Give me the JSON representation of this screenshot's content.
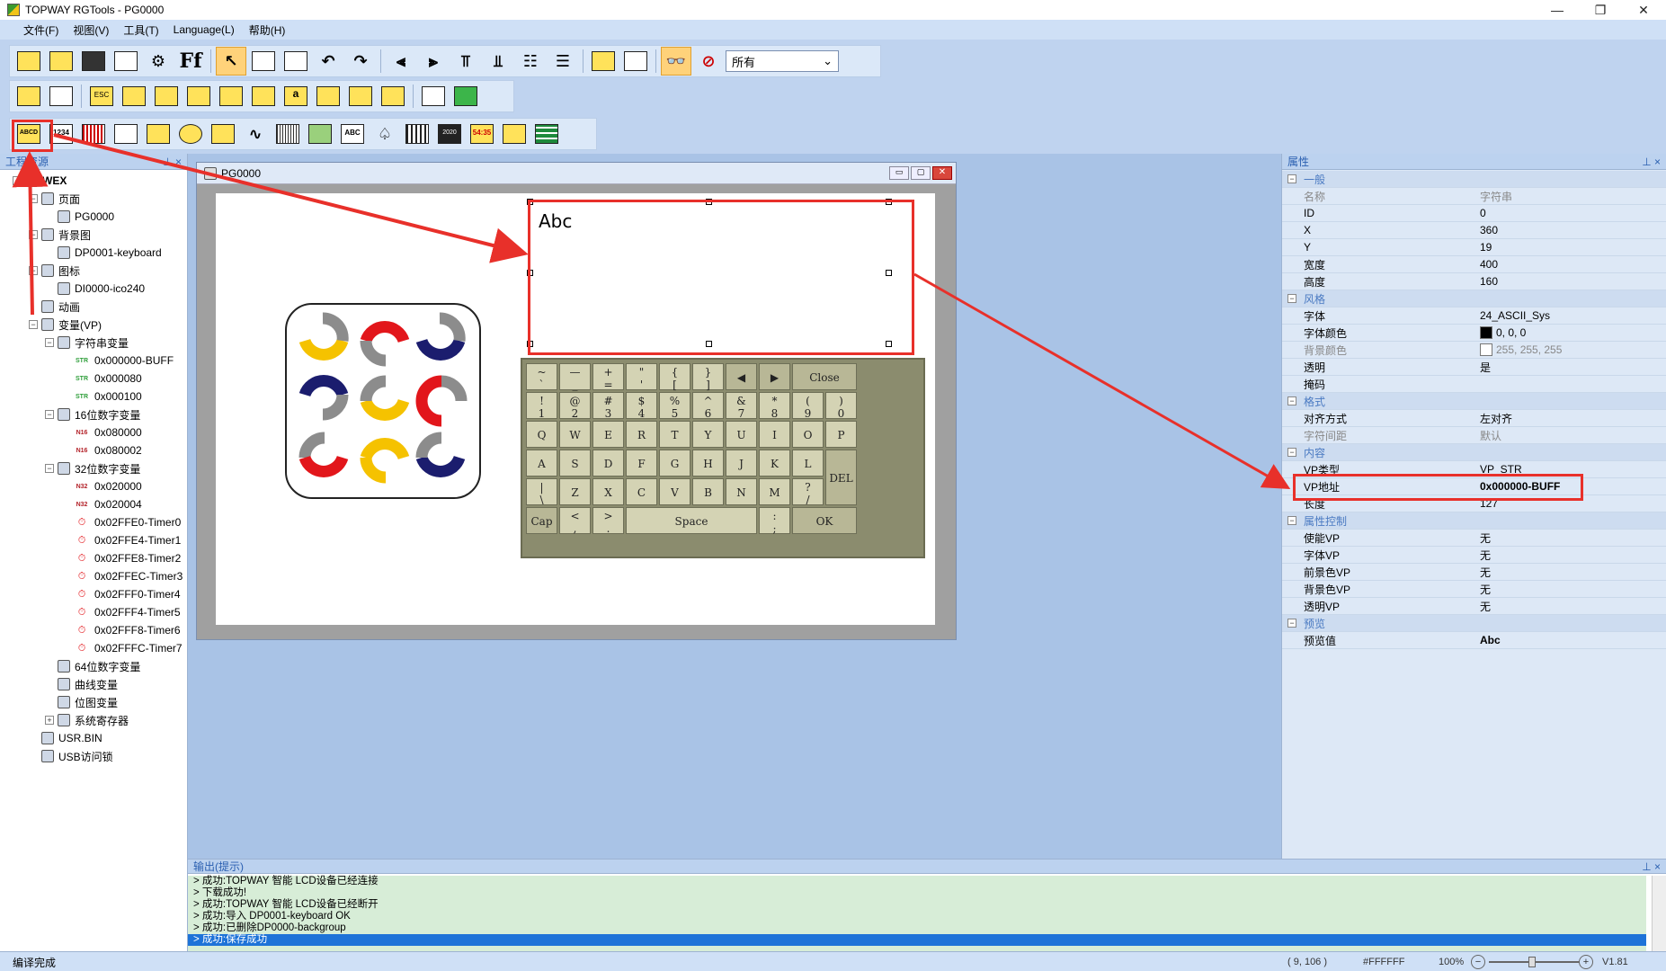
{
  "window": {
    "title": "TOPWAY RGTools - PG0000",
    "min": "—",
    "restore": "❐",
    "close": "✕"
  },
  "menu": [
    "文件(F)",
    "视图(V)",
    "工具(T)",
    "Language(L)",
    "帮助(H)"
  ],
  "toolbar": {
    "filter_value": "所有",
    "row1_icons": [
      "new-icon",
      "open-icon",
      "save-icon",
      "save-as-icon",
      "settings-icon",
      "font-icon",
      "pointer-icon",
      "copy-icon",
      "paste-icon",
      "undo-icon",
      "redo-icon",
      "align-left-icon",
      "align-right-icon",
      "align-top-icon",
      "align-bottom-icon",
      "distribute-icon",
      "distribute-v-icon",
      "bring-front-icon",
      "send-back-icon",
      "preview-icon",
      "preview-off-icon"
    ],
    "row2_icons": [
      "rect-icon",
      "rect-outline-icon",
      "key-esc-icon",
      "key-backspace-icon",
      "key-left-icon",
      "key-right-icon",
      "key-enter-icon",
      "key-home-icon",
      "key-a-icon",
      "grid-icon",
      "grid2-icon",
      "grid3-icon",
      "compile-icon",
      "download-icon"
    ],
    "row3_icons": [
      "text-abcd-icon",
      "number-1234-icon",
      "bar-icon",
      "icon-widget-icon",
      "badge-icon",
      "gauge-icon",
      "animation-icon",
      "curve-icon",
      "scale-icon",
      "qr-icon",
      "abc-icon",
      "spade-icon",
      "film-icon",
      "date-icon",
      "clock-icon",
      "xy-icon",
      "table-icon"
    ],
    "row1_labels": {
      "font": "Ff"
    },
    "row3_labels": {
      "text": "ABCD",
      "number": "1234",
      "abc": "ABC",
      "date": "2020",
      "clock": "54:35"
    }
  },
  "left_panel": {
    "title": "工程资源",
    "pin": "⊥ ×",
    "tree": [
      {
        "label": "WEX",
        "level": 0,
        "node": "−",
        "bold": true
      },
      {
        "label": "页面",
        "level": 1,
        "node": "−"
      },
      {
        "label": "PG0000",
        "level": 2
      },
      {
        "label": "背景图",
        "level": 1,
        "node": "−"
      },
      {
        "label": "DP0001-keyboard",
        "level": 2
      },
      {
        "label": "图标",
        "level": 1,
        "node": "−"
      },
      {
        "label": "DI0000-ico240",
        "level": 2
      },
      {
        "label": "动画",
        "level": 1
      },
      {
        "label": "变量(VP)",
        "level": 1,
        "node": "−"
      },
      {
        "label": "字符串变量",
        "level": 2,
        "node": "−"
      },
      {
        "label": "0x000000-BUFF",
        "level": 3,
        "tag": "STR"
      },
      {
        "label": "0x000080",
        "level": 3,
        "tag": "STR"
      },
      {
        "label": "0x000100",
        "level": 3,
        "tag": "STR"
      },
      {
        "label": "16位数字变量",
        "level": 2,
        "node": "−"
      },
      {
        "label": "0x080000",
        "level": 3,
        "tag": "N16"
      },
      {
        "label": "0x080002",
        "level": 3,
        "tag": "N16"
      },
      {
        "label": "32位数字变量",
        "level": 2,
        "node": "−"
      },
      {
        "label": "0x020000",
        "level": 3,
        "tag": "N32"
      },
      {
        "label": "0x020004",
        "level": 3,
        "tag": "N32"
      },
      {
        "label": "0x02FFE0-Timer0",
        "level": 3,
        "tag": "timer"
      },
      {
        "label": "0x02FFE4-Timer1",
        "level": 3,
        "tag": "timer"
      },
      {
        "label": "0x02FFE8-Timer2",
        "level": 3,
        "tag": "timer"
      },
      {
        "label": "0x02FFEC-Timer3",
        "level": 3,
        "tag": "timer"
      },
      {
        "label": "0x02FFF0-Timer4",
        "level": 3,
        "tag": "timer"
      },
      {
        "label": "0x02FFF4-Timer5",
        "level": 3,
        "tag": "timer"
      },
      {
        "label": "0x02FFF8-Timer6",
        "level": 3,
        "tag": "timer"
      },
      {
        "label": "0x02FFFC-Timer7",
        "level": 3,
        "tag": "timer"
      },
      {
        "label": "64位数字变量",
        "level": 2
      },
      {
        "label": "曲线变量",
        "level": 2
      },
      {
        "label": "位图变量",
        "level": 2
      },
      {
        "label": "系统寄存器",
        "level": 2,
        "node": "+"
      },
      {
        "label": "USR.BIN",
        "level": 1
      },
      {
        "label": "USB访问锁",
        "level": 1
      }
    ]
  },
  "document": {
    "title": "PG0000",
    "text_widget": "Abc",
    "keyboard": {
      "row0": [
        [
          "~",
          "`"
        ],
        [
          "—",
          "_"
        ],
        [
          "+",
          "="
        ],
        [
          "\"",
          "'"
        ],
        [
          "{",
          "["
        ],
        [
          "}",
          "]"
        ],
        [
          "◀",
          ""
        ],
        [
          "▶",
          ""
        ],
        [
          "Close",
          ""
        ]
      ],
      "row1": [
        [
          "!",
          "1"
        ],
        [
          "@",
          "2"
        ],
        [
          "#",
          "3"
        ],
        [
          "$",
          "4"
        ],
        [
          "%",
          "5"
        ],
        [
          "^",
          "6"
        ],
        [
          "&",
          "7"
        ],
        [
          "*",
          "8"
        ],
        [
          "(",
          "9"
        ],
        [
          ")",
          "0"
        ]
      ],
      "row2": [
        "Q",
        "W",
        "E",
        "R",
        "T",
        "Y",
        "U",
        "I",
        "O",
        "P"
      ],
      "row3": [
        [
          "A",
          ""
        ],
        [
          "S",
          ""
        ],
        [
          "D",
          ""
        ],
        [
          "F",
          ""
        ],
        [
          "G",
          ""
        ],
        [
          "H",
          ""
        ],
        [
          "J",
          ""
        ],
        [
          "K",
          ""
        ],
        [
          "L",
          ""
        ]
      ],
      "row4": [
        [
          "|",
          "\\"
        ],
        [
          "Z",
          ""
        ],
        [
          "X",
          ""
        ],
        [
          "C",
          ""
        ],
        [
          "V",
          ""
        ],
        [
          "B",
          ""
        ],
        [
          "N",
          ""
        ],
        [
          "M",
          ""
        ],
        [
          "?",
          "/"
        ]
      ],
      "row5": {
        "cap": "Cap",
        "lt": "<",
        "lt2": ",",
        "gt": ">",
        "gt2": ".",
        "space": "Space",
        "colon": ":",
        "colon2": ";",
        "ok": "OK"
      },
      "del": "DEL"
    }
  },
  "properties": {
    "title": "属性",
    "pin": "⊥ ×",
    "rows": [
      {
        "type": "cat",
        "key": "一般",
        "exp": "−"
      },
      {
        "key": "名称",
        "value": "字符串",
        "gray": true
      },
      {
        "key": "ID",
        "value": "0"
      },
      {
        "key": "X",
        "value": "360"
      },
      {
        "key": "Y",
        "value": "19"
      },
      {
        "key": "宽度",
        "value": "400"
      },
      {
        "key": "高度",
        "value": "160"
      },
      {
        "type": "cat",
        "key": "风格",
        "exp": "−"
      },
      {
        "key": "字体",
        "value": "24_ASCII_Sys"
      },
      {
        "key": "字体颜色",
        "value": "0, 0, 0",
        "swatch": "#000000"
      },
      {
        "key": "背景颜色",
        "value": "255, 255, 255",
        "swatch": "#ffffff",
        "gray": true
      },
      {
        "key": "透明",
        "value": "是"
      },
      {
        "key": "掩码",
        "value": ""
      },
      {
        "type": "cat",
        "key": "格式",
        "exp": "−"
      },
      {
        "key": "对齐方式",
        "value": "左对齐"
      },
      {
        "key": "字符间距",
        "value": "默认",
        "gray": true
      },
      {
        "type": "cat",
        "key": "内容",
        "exp": "−"
      },
      {
        "key": "VP类型",
        "value": "VP_STR"
      },
      {
        "key": "VP地址",
        "value": "0x000000-BUFF",
        "bold": true
      },
      {
        "key": "长度",
        "value": "127"
      },
      {
        "type": "cat",
        "key": "属性控制",
        "exp": "−"
      },
      {
        "key": "使能VP",
        "value": "无"
      },
      {
        "key": "字体VP",
        "value": "无"
      },
      {
        "key": "前景色VP",
        "value": "无"
      },
      {
        "key": "背景色VP",
        "value": "无"
      },
      {
        "key": "透明VP",
        "value": "无"
      },
      {
        "type": "cat",
        "key": "预览",
        "exp": "−"
      },
      {
        "key": "预览值",
        "value": "Abc",
        "bold": true
      }
    ]
  },
  "output": {
    "title": "输出(提示)",
    "pin": "⊥ ×",
    "lines": [
      "> 成功:TOPWAY 智能 LCD设备已经连接",
      "> 下载成功!",
      "> 成功:TOPWAY 智能 LCD设备已经断开",
      "> 成功:导入 DP0001-keyboard OK",
      "> 成功:已删除DP0000-backgroup",
      "> 成功:保存成功"
    ]
  },
  "status": {
    "left": "编译完成",
    "coords": "( 9, 106 )",
    "color": "#FFFFFF",
    "zoom": "100%",
    "version": "V1.81",
    "zoom_minus": "−",
    "zoom_plus": "+"
  },
  "colors": {
    "accent_red": "#e8302a",
    "selection_blue": "#1e73d8",
    "logo_red": "#e2161b",
    "logo_yellow": "#f5c200",
    "logo_navy": "#1b1d6e",
    "logo_gray": "#8c8c8c"
  }
}
